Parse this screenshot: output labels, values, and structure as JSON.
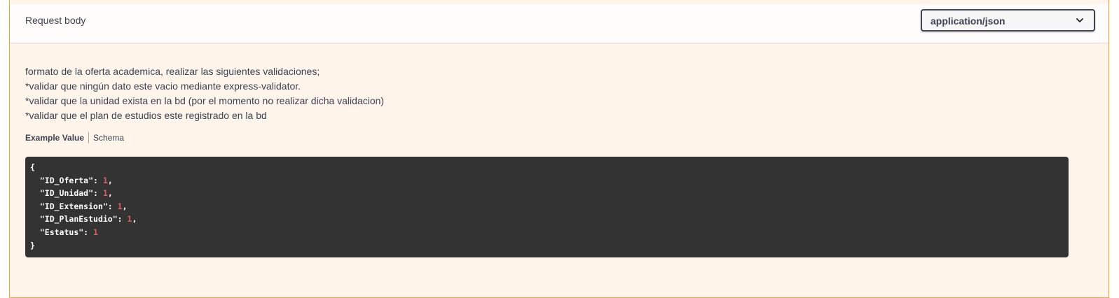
{
  "request_body": {
    "title": "Request body",
    "content_type": "application/json",
    "description_lines": [
      "formato de la oferta academica, realizar las siguientes validaciones;",
      "*validar que ningún dato este vacio mediante express-validator.",
      "*validar que la unidad exista en la bd (por el momento no realizar dicha validacion)",
      "*validar que el plan de estudios este registrado en la bd"
    ],
    "tabs": {
      "example_value": "Example Value",
      "schema": "Schema"
    },
    "example": {
      "open": "{",
      "close": "}",
      "fields": [
        {
          "key": "\"ID_Oferta\"",
          "value": "1",
          "sep": ","
        },
        {
          "key": "\"ID_Unidad\"",
          "value": "1",
          "sep": ","
        },
        {
          "key": "\"ID_Extension\"",
          "value": "1",
          "sep": ","
        },
        {
          "key": "\"ID_PlanEstudio\"",
          "value": "1",
          "sep": ","
        },
        {
          "key": "\"Estatus\"",
          "value": "1",
          "sep": ""
        }
      ]
    }
  },
  "colors": {
    "accent_border": "#fca130",
    "panel_background": "#fff5ea",
    "code_background": "#333333",
    "number_color": "#d36363"
  }
}
